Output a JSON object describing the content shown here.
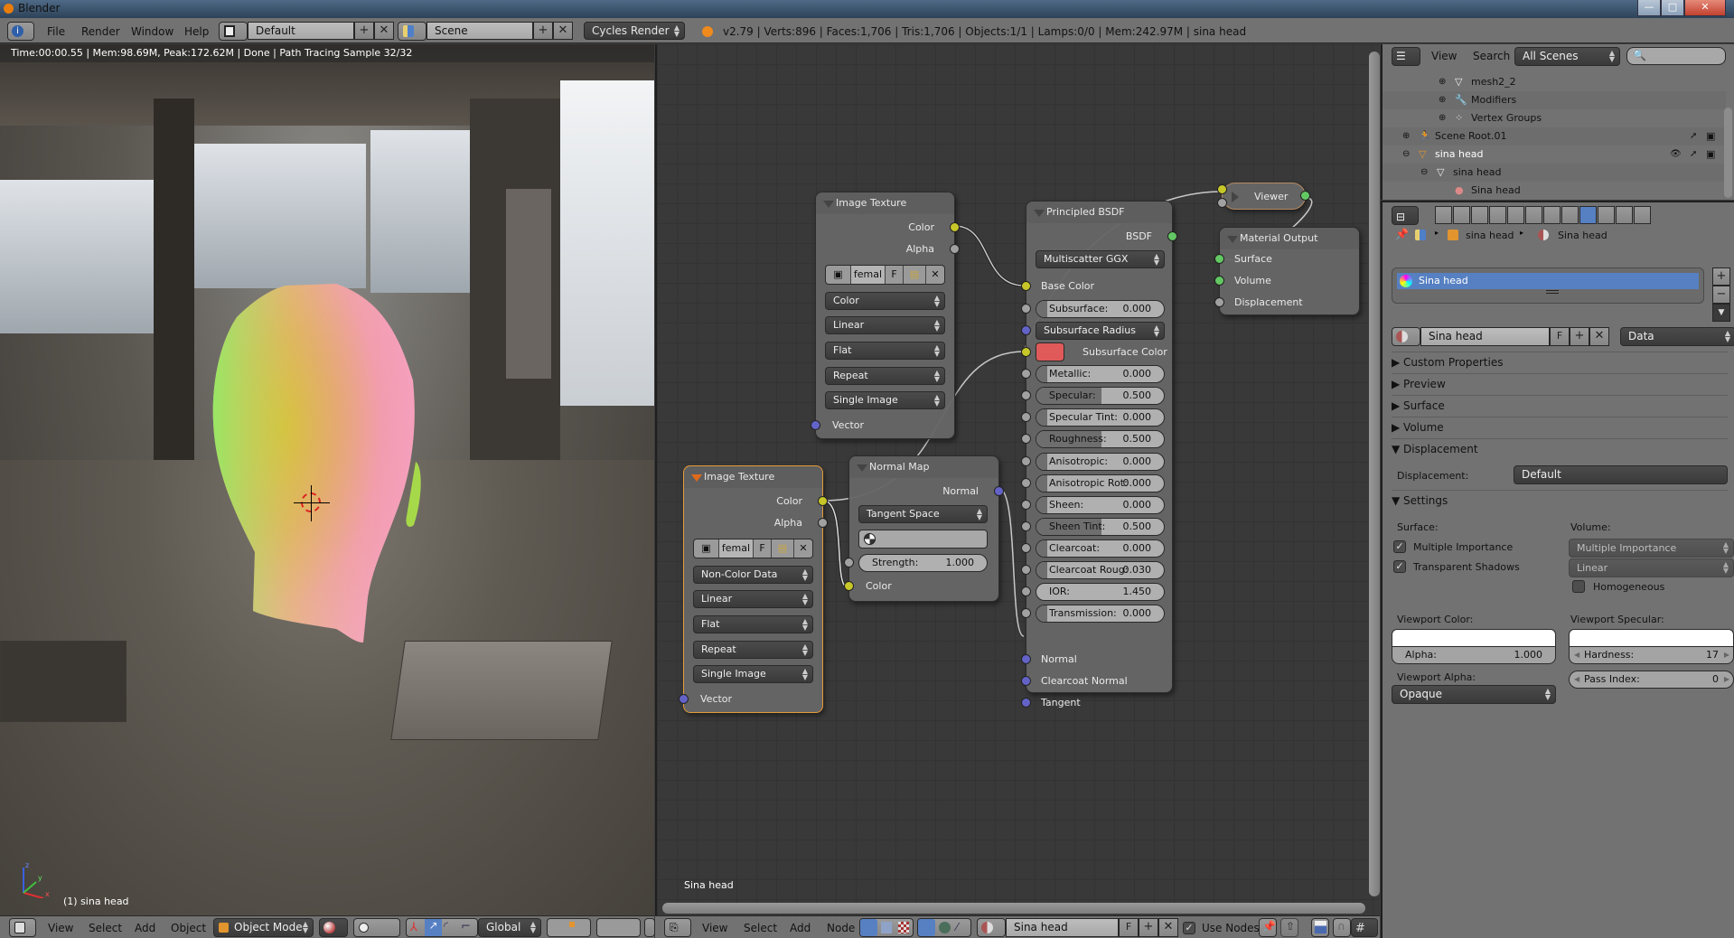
{
  "window": {
    "title": "Blender",
    "controls": {
      "minimize": "—",
      "maximize": "□",
      "close": "✕"
    }
  },
  "info_header": {
    "editor_type_icon": "info-icon",
    "menus": [
      "File",
      "Render",
      "Window",
      "Help"
    ],
    "screen_layout": "Default",
    "scene": "Scene",
    "render_engine": "Cycles Render",
    "stats": "v2.79 | Verts:896 | Faces:1,706 | Tris:1,706 | Objects:1/1 | Lamps:0/0 | Mem:242.97M | sina head"
  },
  "viewport": {
    "render_info": "Time:00:00.55 | Mem:98.69M, Peak:172.62M | Done | Path Tracing Sample 32/32",
    "object_label": "(1) sina head",
    "axes": {
      "x": "x",
      "y": "y",
      "z": "z"
    },
    "header": {
      "menus": [
        "View",
        "Select",
        "Add",
        "Object"
      ],
      "mode": "Object Mode",
      "orientation": "Global"
    }
  },
  "node_editor": {
    "material_name_label": "Sina head",
    "nodes": {
      "image_texture_1": {
        "title": "Image Texture",
        "outputs": [
          "Color",
          "Alpha"
        ],
        "image_name": "femal",
        "fake_user": "F",
        "color_space": "Color",
        "interpolation": "Linear",
        "projection": "Flat",
        "extension": "Repeat",
        "source": "Single Image",
        "input": "Vector"
      },
      "image_texture_2": {
        "title": "Image Texture",
        "outputs": [
          "Color",
          "Alpha"
        ],
        "image_name": "femal",
        "fake_user": "F",
        "color_space": "Non-Color Data",
        "interpolation": "Linear",
        "projection": "Flat",
        "extension": "Repeat",
        "source": "Single Image",
        "input": "Vector"
      },
      "normal_map": {
        "title": "Normal Map",
        "output": "Normal",
        "space": "Tangent Space",
        "strength_label": "Strength:",
        "strength": "1.000",
        "input": "Color"
      },
      "principled": {
        "title": "Principled BSDF",
        "output": "BSDF",
        "distribution": "Multiscatter GGX",
        "base_color_label": "Base Color",
        "subsurface_method": "Subsurface Radius",
        "subsurface_color_label": "Subsurface Color",
        "subsurface_color": "#e05a5a",
        "sliders": [
          {
            "label": "Subsurface:",
            "value": "0.000",
            "fraction": 0.0
          },
          {
            "label": "Metallic:",
            "value": "0.000",
            "fraction": 0.0
          },
          {
            "label": "Specular:",
            "value": "0.500",
            "fraction": 0.5
          },
          {
            "label": "Specular Tint:",
            "value": "0.000",
            "fraction": 0.0
          },
          {
            "label": "Roughness:",
            "value": "0.500",
            "fraction": 0.5
          },
          {
            "label": "Anisotropic:",
            "value": "0.000",
            "fraction": 0.0
          },
          {
            "label": "Anisotropic Rot:",
            "value": "0.000",
            "fraction": 0.0
          },
          {
            "label": "Sheen:",
            "value": "0.000",
            "fraction": 0.0
          },
          {
            "label": "Sheen Tint:",
            "value": "0.500",
            "fraction": 0.5
          },
          {
            "label": "Clearcoat:",
            "value": "0.000",
            "fraction": 0.0
          },
          {
            "label": "Clearcoat Roug:",
            "value": "0.030",
            "fraction": 0.03
          },
          {
            "label": "IOR:",
            "value": "1.450",
            "fraction": null
          },
          {
            "label": "Transmission:",
            "value": "0.000",
            "fraction": 0.0
          }
        ],
        "vector_inputs": [
          "Normal",
          "Clearcoat Normal",
          "Tangent"
        ]
      },
      "viewer": {
        "title": "Viewer"
      },
      "material_output": {
        "title": "Material Output",
        "inputs": [
          "Surface",
          "Volume",
          "Displacement"
        ]
      }
    },
    "header": {
      "menus": [
        "View",
        "Select",
        "Add",
        "Node"
      ],
      "material": "Sina head",
      "fake_user": "F",
      "use_nodes_label": "Use Nodes",
      "use_nodes": true
    }
  },
  "outliner": {
    "header": {
      "menus": [
        "View",
        "Search"
      ],
      "display_mode": "All Scenes",
      "search_placeholder": ""
    },
    "rows": [
      {
        "label": "mesh2_2",
        "icon": "mesh-data-icon",
        "depth": 3
      },
      {
        "label": "Modifiers",
        "icon": "wrench-icon",
        "depth": 3
      },
      {
        "label": "Vertex Groups",
        "icon": "vertex-groups-icon",
        "depth": 3
      },
      {
        "label": "Scene Root.01",
        "icon": "armature-icon",
        "depth": 1
      },
      {
        "label": "sina head",
        "icon": "mesh-object-icon",
        "depth": 1,
        "selected": true
      },
      {
        "label": "sina head",
        "icon": "mesh-data-icon",
        "depth": 2
      },
      {
        "label": "Sina head",
        "icon": "material-icon",
        "depth": 3
      }
    ]
  },
  "properties": {
    "breadcrumb": [
      "sina head",
      "Sina head"
    ],
    "material_slots": [
      "Sina head"
    ],
    "material_datablock": "Sina head",
    "fake_user": "F",
    "link": "Data",
    "panels": {
      "custom_properties": "Custom Properties",
      "preview": "Preview",
      "surface": "Surface",
      "volume": "Volume",
      "displacement": "Displacement",
      "settings": "Settings"
    },
    "displacement": {
      "label": "Displacement:",
      "value": "Default"
    },
    "settings": {
      "surface_label": "Surface:",
      "volume_label": "Volume:",
      "multiple_importance": {
        "label": "Multiple Importance",
        "checked": true
      },
      "transparent_shadows": {
        "label": "Transparent Shadows",
        "checked": true
      },
      "volume_sampling": "Multiple Importance",
      "volume_interpolation": "Linear",
      "homogeneous": {
        "label": "Homogeneous",
        "checked": false
      },
      "viewport_color_label": "Viewport Color:",
      "viewport_specular_label": "Viewport Specular:",
      "alpha_label": "Alpha:",
      "alpha": "1.000",
      "hardness_label": "Hardness:",
      "hardness": "17",
      "viewport_alpha_label": "Viewport Alpha:",
      "viewport_alpha": "Opaque",
      "pass_index_label": "Pass Index:",
      "pass_index": "0"
    }
  }
}
